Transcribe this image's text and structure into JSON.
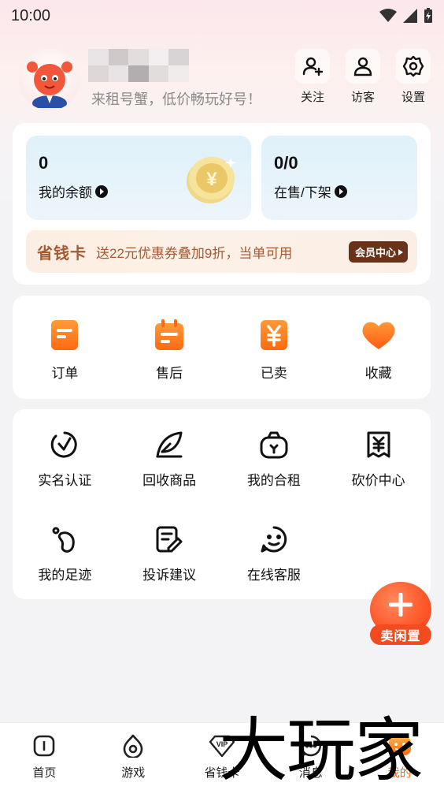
{
  "status_bar": {
    "time": "10:00"
  },
  "profile": {
    "slogan": "来租号蟹，低价畅玩好号！"
  },
  "top_actions": [
    {
      "label": "关注",
      "icon": "add-user-icon"
    },
    {
      "label": "访客",
      "icon": "person-icon"
    },
    {
      "label": "设置",
      "icon": "gear-icon"
    }
  ],
  "wallet": {
    "balance_value": "0",
    "balance_label": "我的余额",
    "listing_value": "0/0",
    "listing_label": "在售/下架"
  },
  "save_card": {
    "title": "省钱卡",
    "description": "送22元优惠券叠加9折，当单可用",
    "button_label": "会员中心"
  },
  "orders": [
    {
      "label": "订单",
      "icon": "order-list-icon"
    },
    {
      "label": "售后",
      "icon": "calendar-icon"
    },
    {
      "label": "已卖",
      "icon": "yuan-icon"
    },
    {
      "label": "收藏",
      "icon": "heart-icon"
    }
  ],
  "tools": [
    {
      "label": "实名认证",
      "icon": "verify-icon"
    },
    {
      "label": "回收商品",
      "icon": "leaf-icon"
    },
    {
      "label": "我的合租",
      "icon": "bag-icon"
    },
    {
      "label": "砍价中心",
      "icon": "price-ticket-icon"
    },
    {
      "label": "我的足迹",
      "icon": "footprint-icon"
    },
    {
      "label": "投诉建议",
      "icon": "edit-note-icon"
    },
    {
      "label": "在线客服",
      "icon": "chat-face-icon"
    }
  ],
  "sell_fab": {
    "label": "卖闲置"
  },
  "tabbar": [
    {
      "label": "首页",
      "icon": "home-icon"
    },
    {
      "label": "游戏",
      "icon": "game-icon"
    },
    {
      "label": "省钱卡",
      "icon": "vip-icon"
    },
    {
      "label": "消息",
      "icon": "message-icon"
    },
    {
      "label": "我的",
      "icon": "profile-icon",
      "active": true
    }
  ],
  "watermark": {
    "text": "大玩家"
  },
  "colors": {
    "accent": "#ff6a1a",
    "brand_brown": "#a55a32",
    "card_bg": "#ffffff",
    "page_bg": "#f3f3f5"
  }
}
